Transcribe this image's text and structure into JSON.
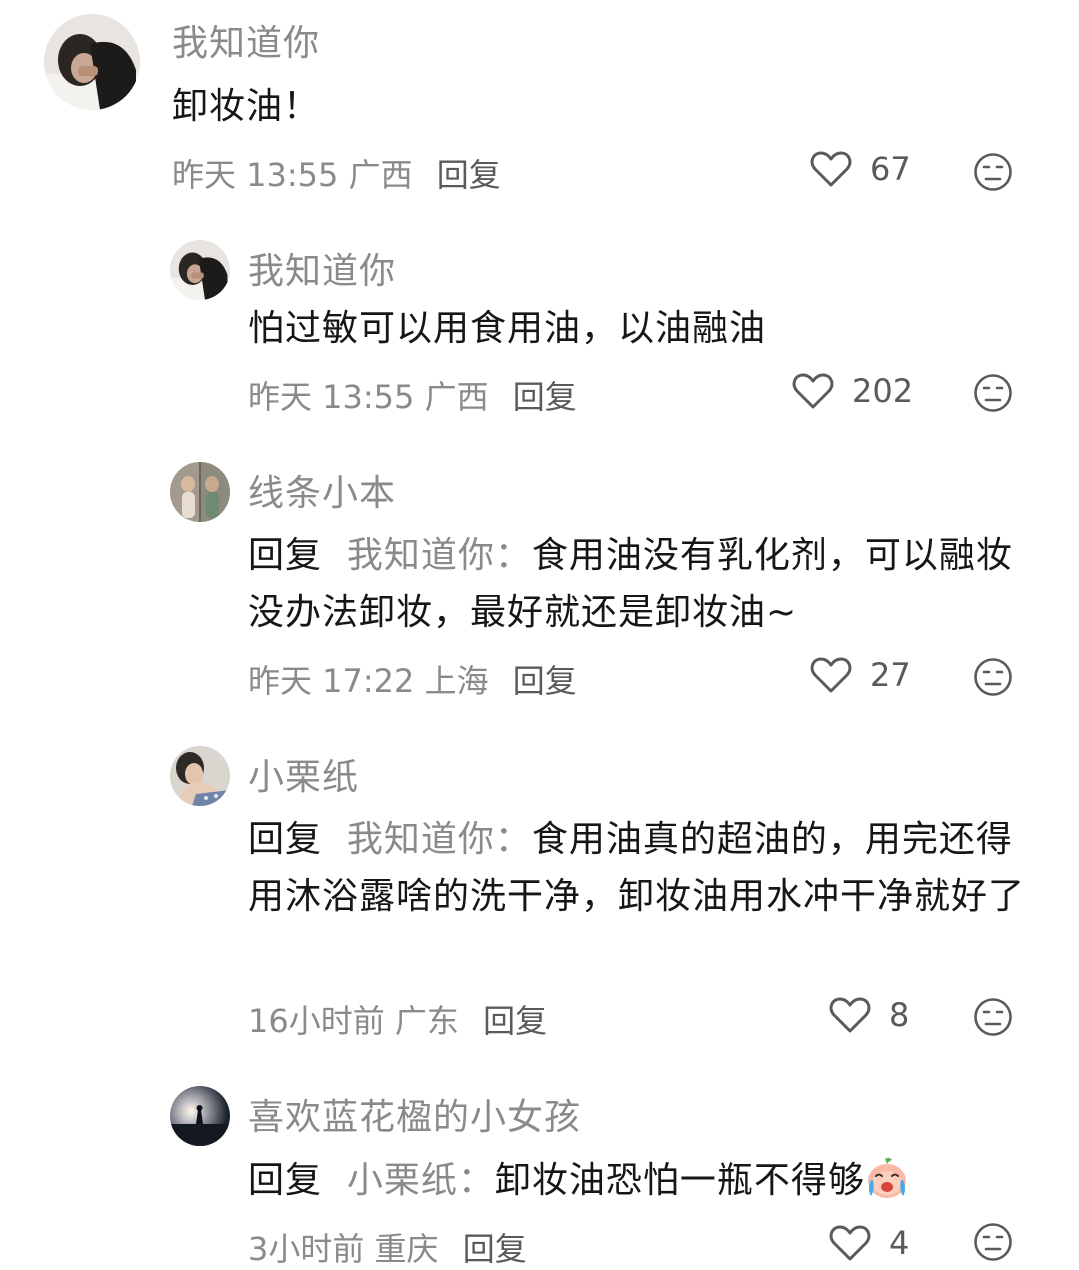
{
  "comments": [
    {
      "author": "我知道你",
      "text": "卸妆油！",
      "time": "昨天 13:55",
      "location": "广西",
      "reply_label": "回复",
      "likes": "67"
    },
    {
      "author": "我知道你",
      "text": "怕过敏可以用食用油，以油融油",
      "time": "昨天 13:55",
      "location": "广西",
      "reply_label": "回复",
      "likes": "202"
    },
    {
      "author": "线条小本",
      "prefix": "回复",
      "reply_to": "我知道你：",
      "text": "食用油没有乳化剂，可以融妆没办法卸妆，最好就还是卸妆油~",
      "time": "昨天 17:22",
      "location": "上海",
      "reply_label": "回复",
      "likes": "27"
    },
    {
      "author": "小栗纸",
      "prefix": "回复",
      "reply_to": "我知道你：",
      "text": "食用油真的超油的，用完还得用沐浴露啥的洗干净，卸妆油用水冲干净就好了",
      "time": "16小时前",
      "location": "广东",
      "reply_label": "回复",
      "likes": "8"
    },
    {
      "author": "喜欢蓝花楹的小女孩",
      "prefix": "回复",
      "reply_to": "小栗纸：",
      "text": "卸妆油恐怕一瓶不得够",
      "emoji": "crying-face-emoji",
      "time": "3小时前",
      "location": "重庆",
      "reply_label": "回复",
      "likes": "4"
    }
  ],
  "icons": {
    "like": "heart-outline-icon",
    "dislike": "neutral-face-icon"
  },
  "colors": {
    "text": "#161616",
    "secondary": "#8a8a8a",
    "icon": "#5a5a5a"
  }
}
